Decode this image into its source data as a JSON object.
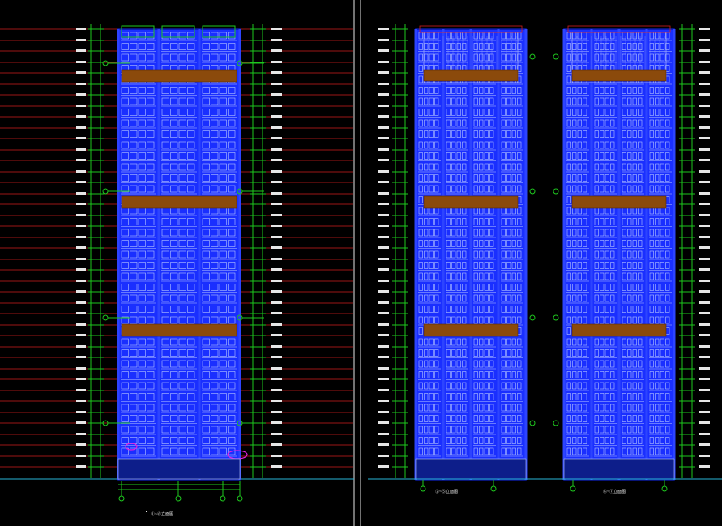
{
  "drawing": {
    "background": "#000000",
    "colors": {
      "facade": "#1a2fff",
      "facade_dark": "#0a1aa0",
      "window_line": "#b8c8ff",
      "band": "#8b4a0c",
      "green": "#1ec81e",
      "red": "#d21e1e",
      "magenta": "#e020e0",
      "cyan": "#29b6d8",
      "white": "#e6e6e6"
    },
    "left_elevation": {
      "caption": "①~⑥立面图"
    },
    "right_elevation": {
      "captions": [
        "②~⑤立面图",
        "⑥~⑦立面图"
      ]
    }
  }
}
